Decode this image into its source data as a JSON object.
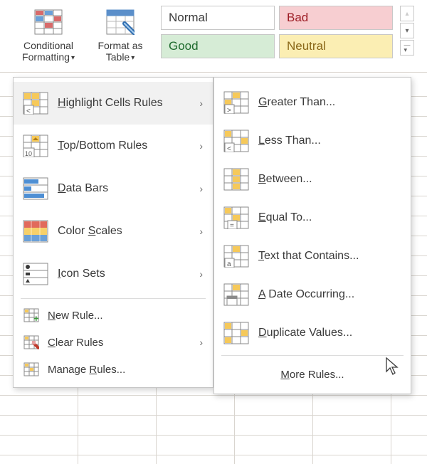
{
  "ribbon": {
    "conditional_formatting": "Conditional Formatting",
    "format_as_table": "Format as Table",
    "styles": {
      "normal": "Normal",
      "bad": "Bad",
      "good": "Good",
      "neutral": "Neutral"
    }
  },
  "menu": {
    "highlight_cells": "Highlight Cells Rules",
    "top_bottom": "Top/Bottom Rules",
    "data_bars": "Data Bars",
    "color_scales": "Color Scales",
    "icon_sets": "Icon Sets",
    "new_rule": "New Rule...",
    "clear_rules": "Clear Rules",
    "manage_rules": "Manage Rules..."
  },
  "submenu": {
    "greater_than": "Greater Than...",
    "less_than": "Less Than...",
    "between": "Between...",
    "equal_to": "Equal To...",
    "text_contains": "Text that Contains...",
    "date_occurring": "A Date Occurring...",
    "duplicate_values": "Duplicate Values...",
    "more_rules": "More Rules..."
  }
}
